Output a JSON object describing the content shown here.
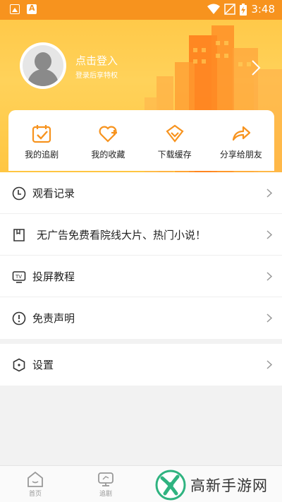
{
  "status_bar": {
    "time": "3:48"
  },
  "header": {
    "login_title": "点击登入",
    "login_subtitle": "登录后享特权"
  },
  "quick_actions": [
    {
      "label": "我的追剧",
      "icon": "calendar-check-icon"
    },
    {
      "label": "我的收藏",
      "icon": "heart-plus-icon"
    },
    {
      "label": "下载缓存",
      "icon": "download-box-icon"
    },
    {
      "label": "分享给朋友",
      "icon": "share-arrow-icon"
    }
  ],
  "menu": {
    "history": "观看记录",
    "noads": "无广告免费看院线大片、热门小说！",
    "cast": "投屏教程",
    "disclaimer": "免责声明",
    "settings": "设置"
  },
  "bottom_nav": {
    "home": "首页",
    "follow": "追剧"
  },
  "watermark": {
    "text": "高新手游网"
  },
  "colors": {
    "status_bar": "#f7931e",
    "header_bg": "#ffc949",
    "accent": "#f7931e",
    "watermark_green": "#2fb380"
  }
}
